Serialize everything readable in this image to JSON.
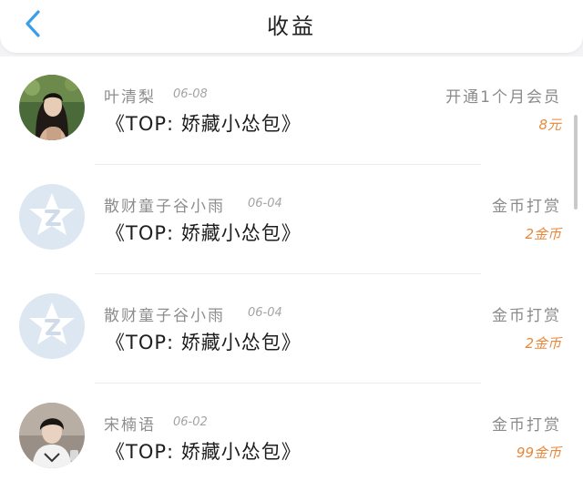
{
  "header": {
    "title": "收益",
    "back_icon": "chevron-left-icon",
    "accent": "#3b9ee8"
  },
  "records": [
    {
      "name": "叶清梨",
      "date": "06-08",
      "book": "《TOP: 娇藏小怂包》",
      "type": "开通1个月会员",
      "amount": "8元",
      "avatar": "photo-female"
    },
    {
      "name": "散财童子谷小雨",
      "date": "06-04",
      "book": "《TOP: 娇藏小怂包》",
      "type": "金币打赏",
      "amount": "2金币",
      "avatar": "default-star-icon"
    },
    {
      "name": "散财童子谷小雨",
      "date": "06-04",
      "book": "《TOP: 娇藏小怂包》",
      "type": "金币打赏",
      "amount": "2金币",
      "avatar": "default-star-icon"
    },
    {
      "name": "宋楠语",
      "date": "06-02",
      "book": "《TOP: 娇藏小怂包》",
      "type": "金币打赏",
      "amount": "99金币",
      "avatar": "photo-male"
    }
  ],
  "colors": {
    "amount": "#e8883a",
    "default_avatar_bg": "#dde7f2"
  }
}
